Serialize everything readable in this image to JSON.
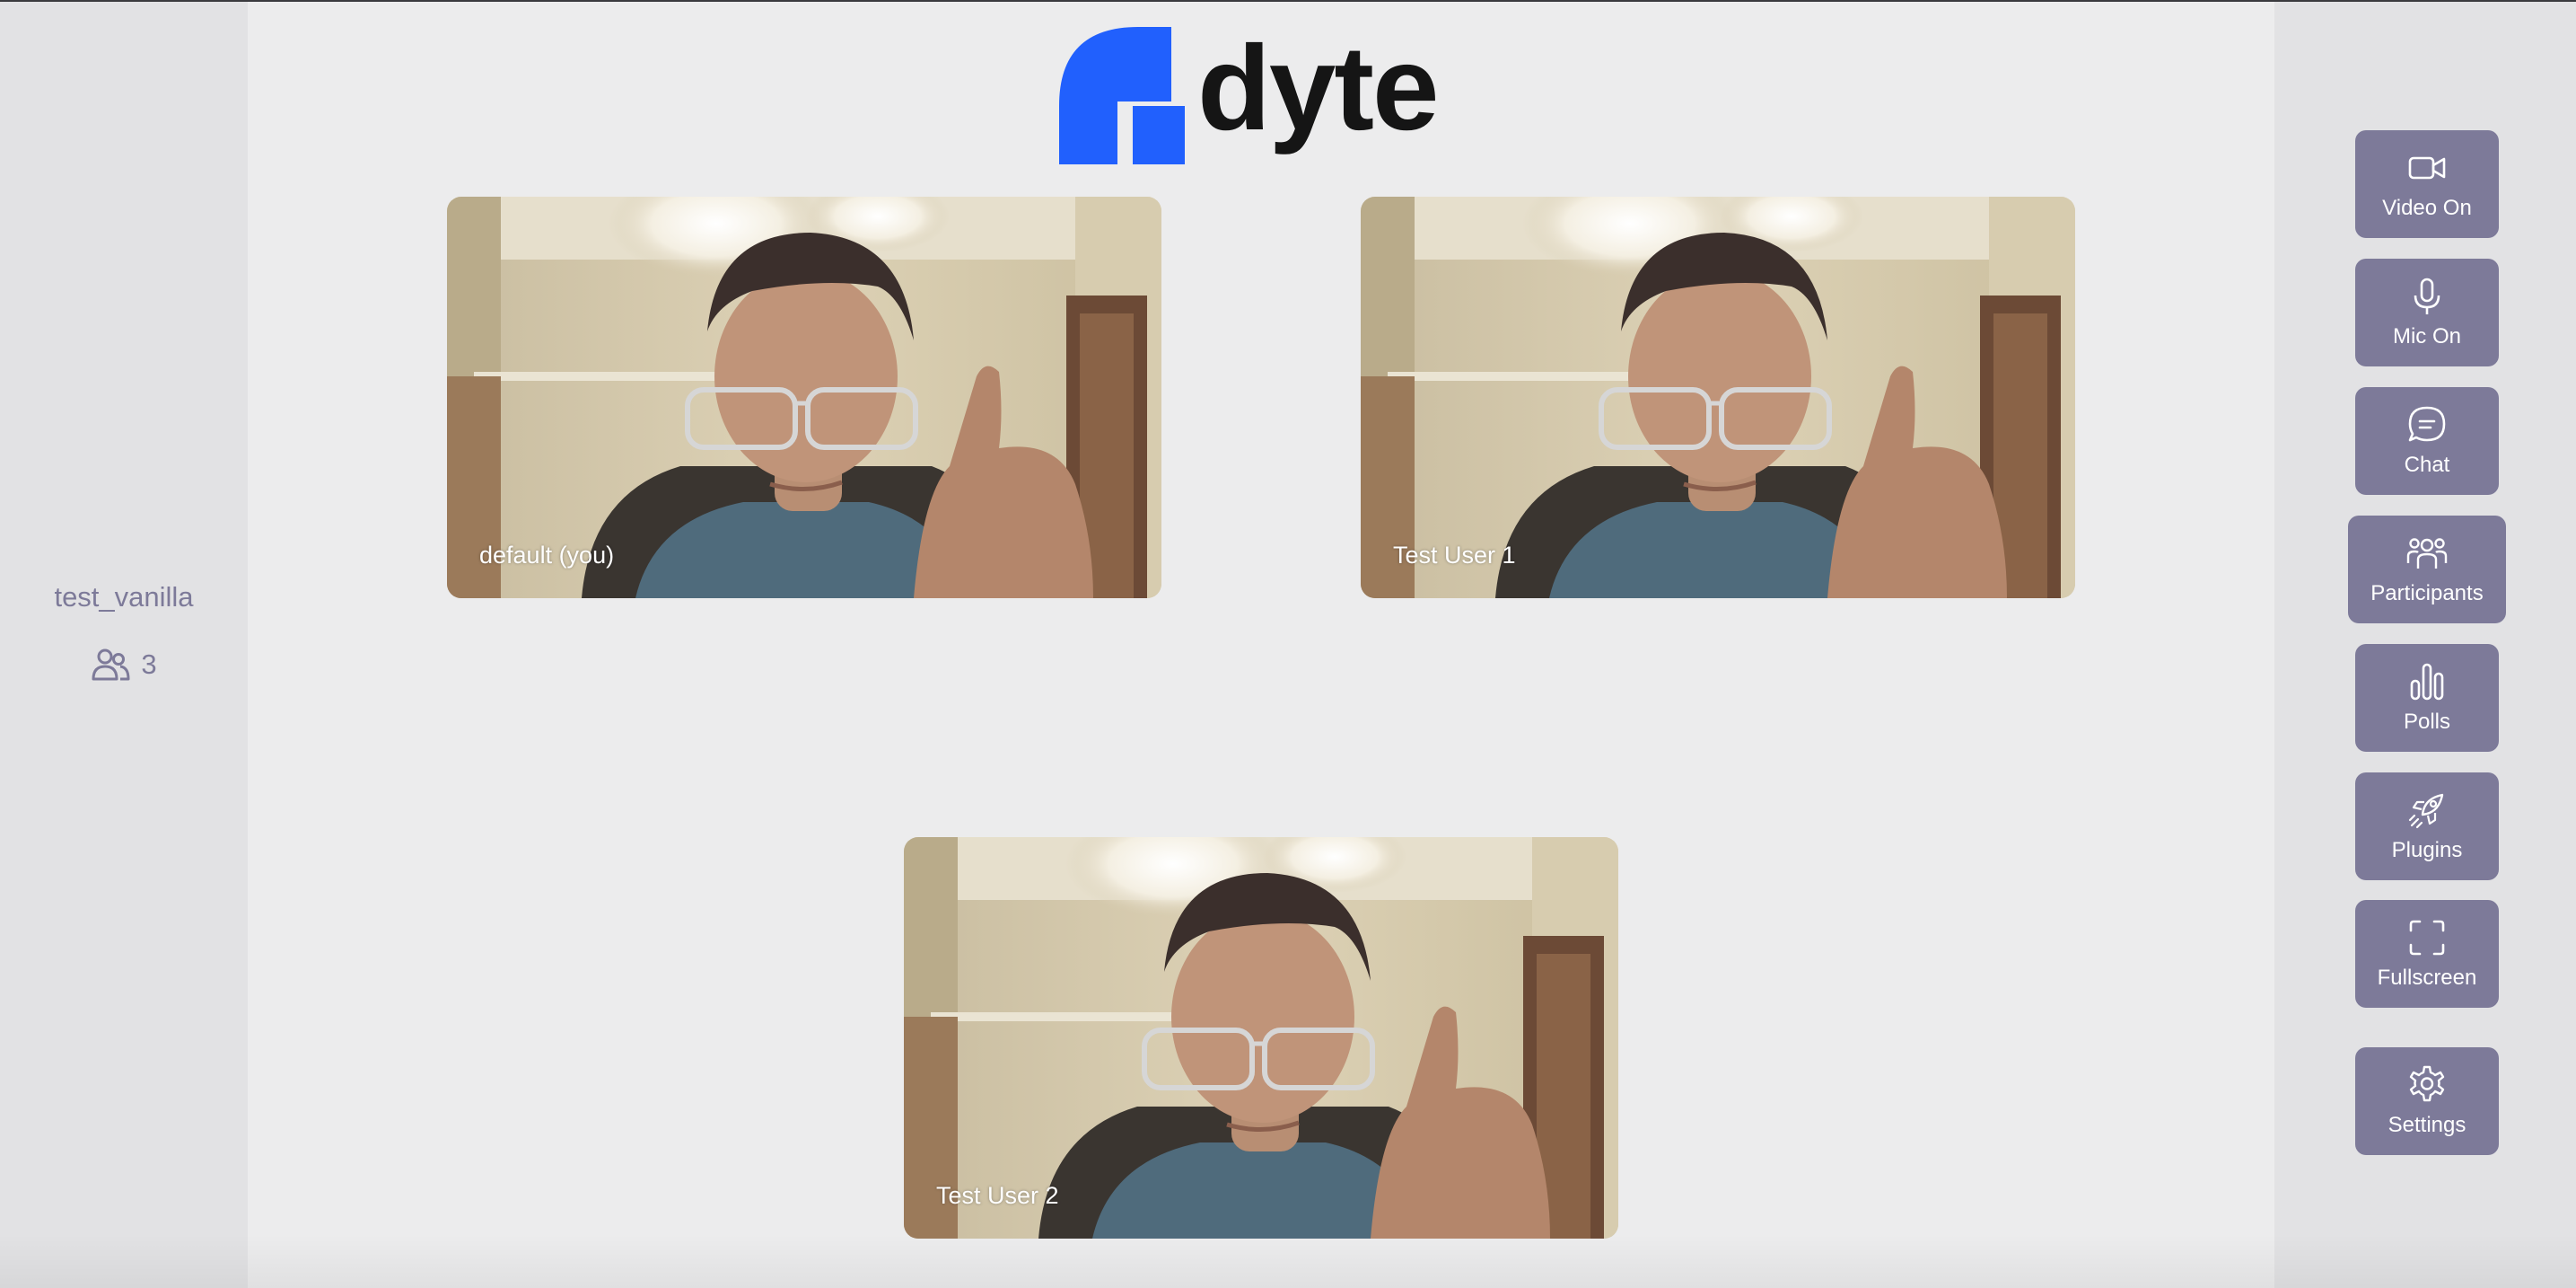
{
  "meeting": {
    "title": "test_vanilla",
    "participant_count": "3"
  },
  "logo": {
    "text": "dyte",
    "brand_color": "#2160fd"
  },
  "tiles": [
    {
      "name": "default (you)"
    },
    {
      "name": "Test User 1"
    },
    {
      "name": "Test User 2"
    }
  ],
  "controls": {
    "video": {
      "label": "Video On",
      "icon": "video-camera-icon"
    },
    "mic": {
      "label": "Mic On",
      "icon": "microphone-icon"
    },
    "chat": {
      "label": "Chat",
      "icon": "chat-bubble-icon"
    },
    "participants": {
      "label": "Participants",
      "icon": "people-icon"
    },
    "polls": {
      "label": "Polls",
      "icon": "bar-chart-icon"
    },
    "plugins": {
      "label": "Plugins",
      "icon": "rocket-icon"
    },
    "fullscreen": {
      "label": "Fullscreen",
      "icon": "fullscreen-icon"
    },
    "settings": {
      "label": "Settings",
      "icon": "gear-icon"
    }
  },
  "colors": {
    "control_bg": "#7d7a99",
    "panel_bg": "#e2e2e4",
    "stage_bg": "#ececed"
  }
}
